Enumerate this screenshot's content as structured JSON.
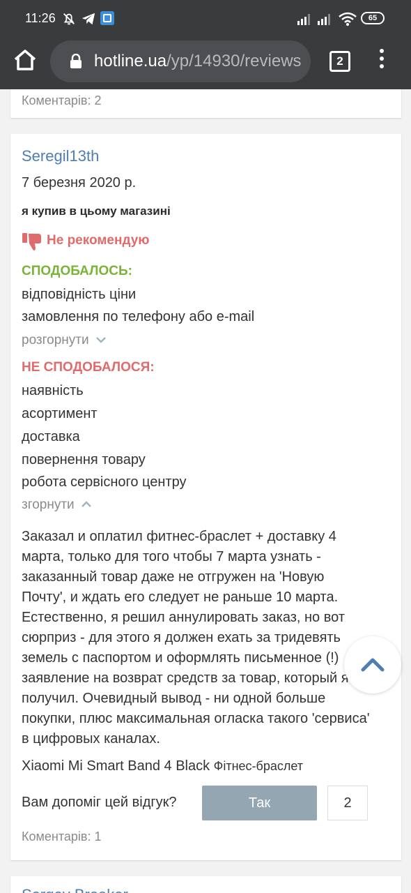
{
  "status_bar": {
    "time": "11:26",
    "battery": "65",
    "icons": [
      "notifications-off-icon",
      "telegram-icon",
      "vpn-app-icon",
      "signal-icon",
      "signal-icon",
      "wifi-icon",
      "battery-icon"
    ]
  },
  "browser": {
    "url_host": "hotline.ua",
    "url_path": "/yp/14930/reviews",
    "tab_count": "2"
  },
  "previous_review": {
    "comments": "Коментарів: 2"
  },
  "review": {
    "author": "Seregil13th",
    "date": "7 березня 2020 р.",
    "purchase_note": "я купив в цьому магазині",
    "verdict": "Не рекомендую",
    "liked_heading": "СПОДОБАЛОСЬ:",
    "liked": [
      "відповідність ціни",
      "замовлення по телефону або e-mail"
    ],
    "liked_toggle": "розгорнути",
    "disliked_heading": "НЕ СПОДОБАЛОСЯ:",
    "disliked": [
      "наявність",
      "асортимент",
      "доставка",
      "повернення товару",
      "робота сервісного центру"
    ],
    "disliked_toggle": "згорнути",
    "text": "Заказал и оплатил фитнес-браслет + доставку 4 марта, только для того чтобы 7 марта узнать - заказанный товар даже не отгружен на 'Новую Почту', и ждать его следует не раньше 10 марта. Естественно, я решил аннулировать заказ, но вот сюрприз - для этого я должен ехать за тридевять земель с паспортом и оформлять письменное (!) заявление на возврат средств за товар, который я не получил. Очевидный вывод - ни одной больше покупки, плюс максимальная огласка такого 'сервиса' в цифровых каналах.",
    "product_name": "Xiaomi Mi Smart Band 4 Black",
    "product_type": "Фітнес-браслет",
    "helpful_question": "Вам допоміг цей відгук?",
    "yes_label": "Так",
    "yes_count": "2",
    "comments": "Коментарів: 1"
  },
  "next_review": {
    "author": "Sergey Breaker"
  },
  "colors": {
    "link": "#4f7db6",
    "liked": "#7bb33a",
    "disliked": "#e06b6b",
    "button": "#94a6b1",
    "chrome": "#3a3b3d"
  }
}
